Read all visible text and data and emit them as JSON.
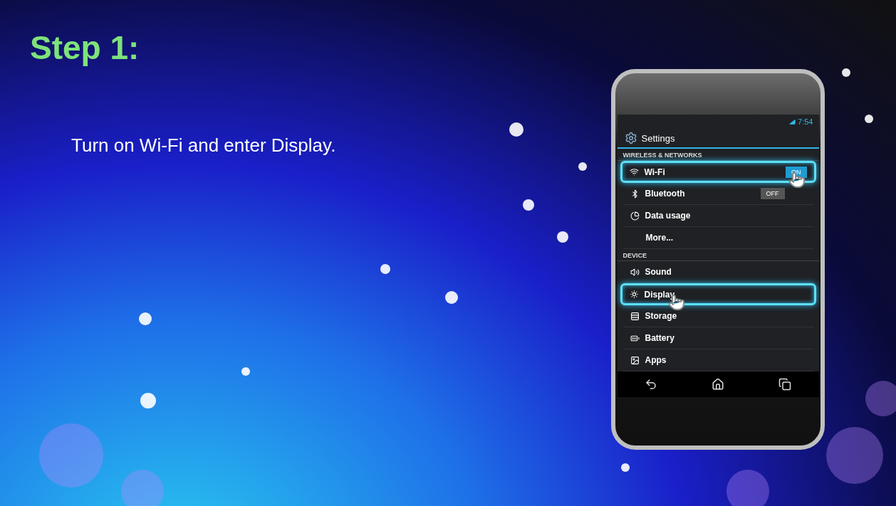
{
  "slide": {
    "title": "Step 1:",
    "instruction": "Turn on Wi-Fi and enter Display."
  },
  "phone": {
    "status_time": "7:54",
    "app_title": "Settings",
    "sections": [
      {
        "header": "WIRELESS & NETWORKS",
        "items": [
          {
            "label": "Wi-Fi",
            "toggle": {
              "label": "ON",
              "on": true
            },
            "highlighted": true,
            "pointer": true
          },
          {
            "label": "Bluetooth",
            "toggle": {
              "label": "OFF",
              "on": false
            },
            "highlighted": false,
            "pointer": false
          },
          {
            "label": "Data usage",
            "highlighted": false,
            "pointer": false
          },
          {
            "label": "More...",
            "highlighted": false,
            "pointer": false
          }
        ]
      },
      {
        "header": "DEVICE",
        "items": [
          {
            "label": "Sound",
            "highlighted": false,
            "pointer": false
          },
          {
            "label": "Display",
            "highlighted": true,
            "pointer": true
          },
          {
            "label": "Storage",
            "highlighted": false,
            "pointer": false
          },
          {
            "label": "Battery",
            "highlighted": false,
            "pointer": false
          },
          {
            "label": "Apps",
            "highlighted": false,
            "pointer": false
          }
        ]
      }
    ]
  }
}
